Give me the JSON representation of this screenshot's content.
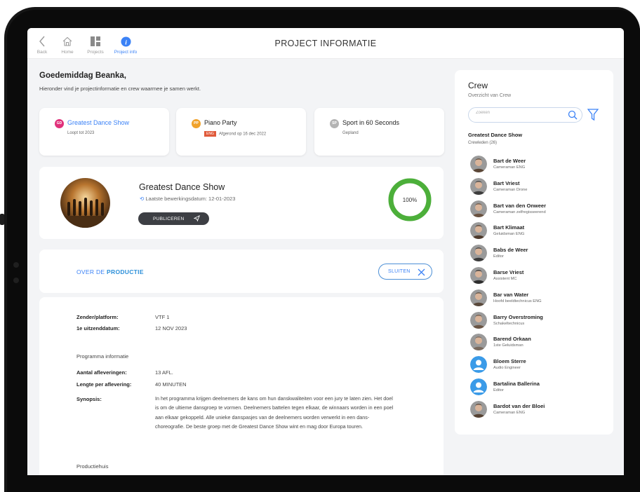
{
  "nav": {
    "back": "Back",
    "home": "Home",
    "projects": "Projects",
    "project_info": "Project info"
  },
  "page_title": "PROJECT INFORMATIE",
  "greeting": "Goedemiddag Beanka,",
  "greeting_sub": "Hieronder vind je projectinformatie en crew waarmee je samen werkt.",
  "projects": [
    {
      "initials": "GD",
      "name": "Greatest Dance Show",
      "sub": "Loopt tot 2023",
      "color": "#e0307a",
      "active": true
    },
    {
      "initials": "PP",
      "name": "Piano Party",
      "tag": "ENG",
      "sub": "Afgerond op 16 dec 2022",
      "color": "#f0a22b"
    },
    {
      "initials": "SP",
      "name": "Sport in 60 Seconds",
      "sub": "Gepland",
      "color": "#b3b3b3"
    }
  ],
  "detail": {
    "title": "Greatest Dance Show",
    "last_edit": "Laatste bewerkingsdatum: 12-01-2023",
    "publish_label": "PUBLICEREN",
    "progress_label": "100%",
    "progress_value": 1.0
  },
  "about": {
    "prefix": "OVER DE",
    "title": "PRODUCTIE",
    "close_label": "SLUITEN"
  },
  "info": {
    "broadcaster_key": "Zender/platform:",
    "broadcaster_val": "VTF 1",
    "first_air_key": "1e uitzenddatum:",
    "first_air_val": "12 NOV 2023",
    "program_heading": "Programma informatie",
    "episodes_key": "Aantal afleveringen:",
    "episodes_val": "13 AFL.",
    "length_key": "Lengte per aflevering:",
    "length_val": "40 MINUTEN",
    "synopsis_key": "Synopsis:",
    "synopsis_val": "In het programma krijgen deelnemers de kans om hun danskwaliteiten voor een jury te laten zien. Het doel is om de ultieme dansgroep te vormen. Deelnemers battelen tegen elkaar, de winnaars worden in een poel aan elkaar gekoppeld. Alle unieke danspasjes van de deelnemers worden verwerkt in een dans-choreografie. De beste groep met de Greatest Dance Show wint en mag door Europa touren.",
    "production_house_heading": "Productiehuis"
  },
  "crew": {
    "title": "Crew",
    "subtitle": "Overzicht van Crew",
    "search_placeholder": "Zoeken",
    "group_title": "Greatest Dance Show",
    "group_count": "Crewleden (26)",
    "members": [
      {
        "name": "Bart de Weer",
        "role": "Cameraman ENG",
        "avatar": "photo"
      },
      {
        "name": "Bart Vriest",
        "role": "Cameraman Drone",
        "avatar": "photo"
      },
      {
        "name": "Bart van den Onweer",
        "role": "Cameraman zelfregisseerend",
        "avatar": "photo"
      },
      {
        "name": "Bart Klimaat",
        "role": "Geluidsman ENG",
        "avatar": "photo"
      },
      {
        "name": "Babs de Weer",
        "role": "Editor",
        "avatar": "photo"
      },
      {
        "name": "Barse Vriest",
        "role": "Assistent MC",
        "avatar": "photo"
      },
      {
        "name": "Bar van Water",
        "role": "Hoofd beeldtechnicus ENG",
        "avatar": "photo"
      },
      {
        "name": "Barry Overstroming",
        "role": "Schakeltechnicus",
        "avatar": "photo"
      },
      {
        "name": "Barend Orkaan",
        "role": "1ste Geluidsman",
        "avatar": "photo"
      },
      {
        "name": "Bloem Sterre",
        "role": "Audio Engineer",
        "avatar": "placeholder"
      },
      {
        "name": "Bartalina Ballerina",
        "role": "Editor",
        "avatar": "placeholder"
      },
      {
        "name": "Bardot van der Bloei",
        "role": "Cameraman ENG",
        "avatar": "photo"
      }
    ]
  },
  "colors": {
    "accent": "#3b82f6",
    "progress": "#4caf3a",
    "publish_bg": "#3d3f44"
  }
}
